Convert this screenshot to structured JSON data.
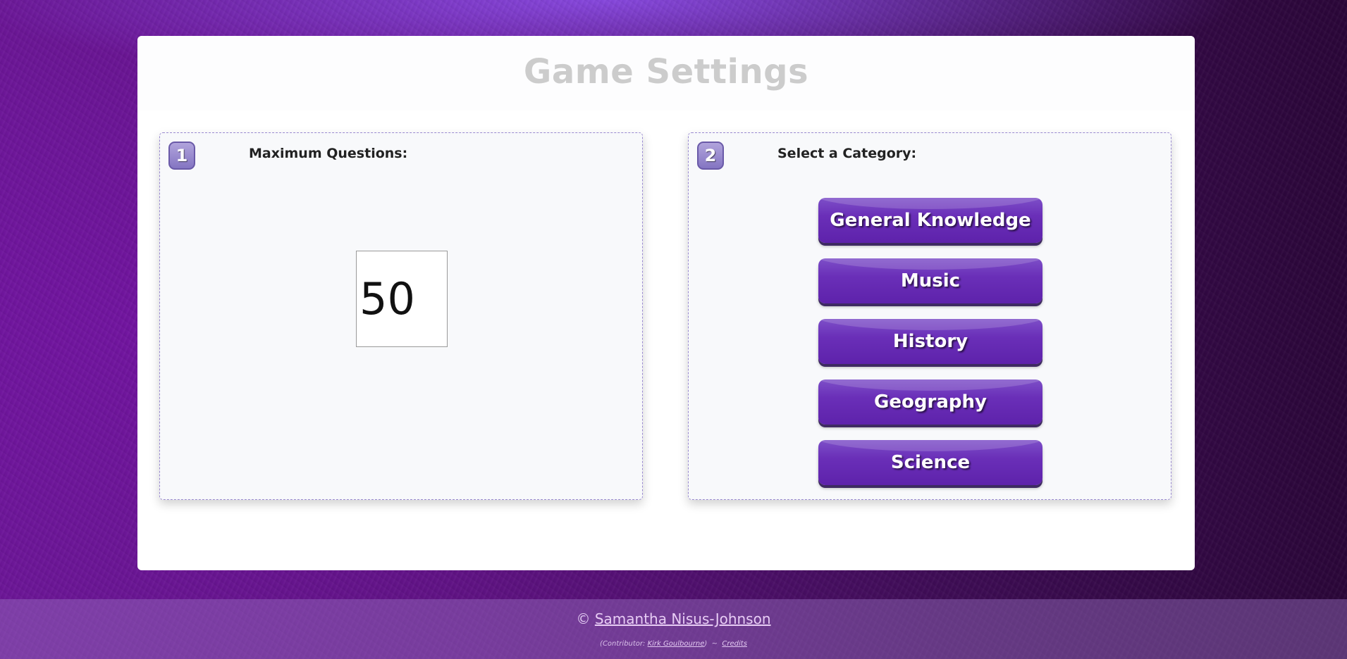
{
  "page": {
    "title": "Game Settings"
  },
  "panels": {
    "questions": {
      "step": "1",
      "label": "Maximum Questions:",
      "value": "50"
    },
    "category": {
      "step": "2",
      "label": "Select a Category:",
      "options": [
        "General Knowledge",
        "Music",
        "History",
        "Geography",
        "Science"
      ]
    }
  },
  "footer": {
    "copyright_symbol": "©",
    "author": "Samantha Nisus-Johnson",
    "contributor_prefix": "(Contributor:",
    "contributor_name": "Kirk Goulbourne",
    "contributor_suffix": ")",
    "separator": "~",
    "credits_label": "Credits"
  },
  "colors": {
    "button_purple": "#6a2fb8",
    "badge_purple": "#8475c2",
    "title_gray": "#cccccc"
  }
}
